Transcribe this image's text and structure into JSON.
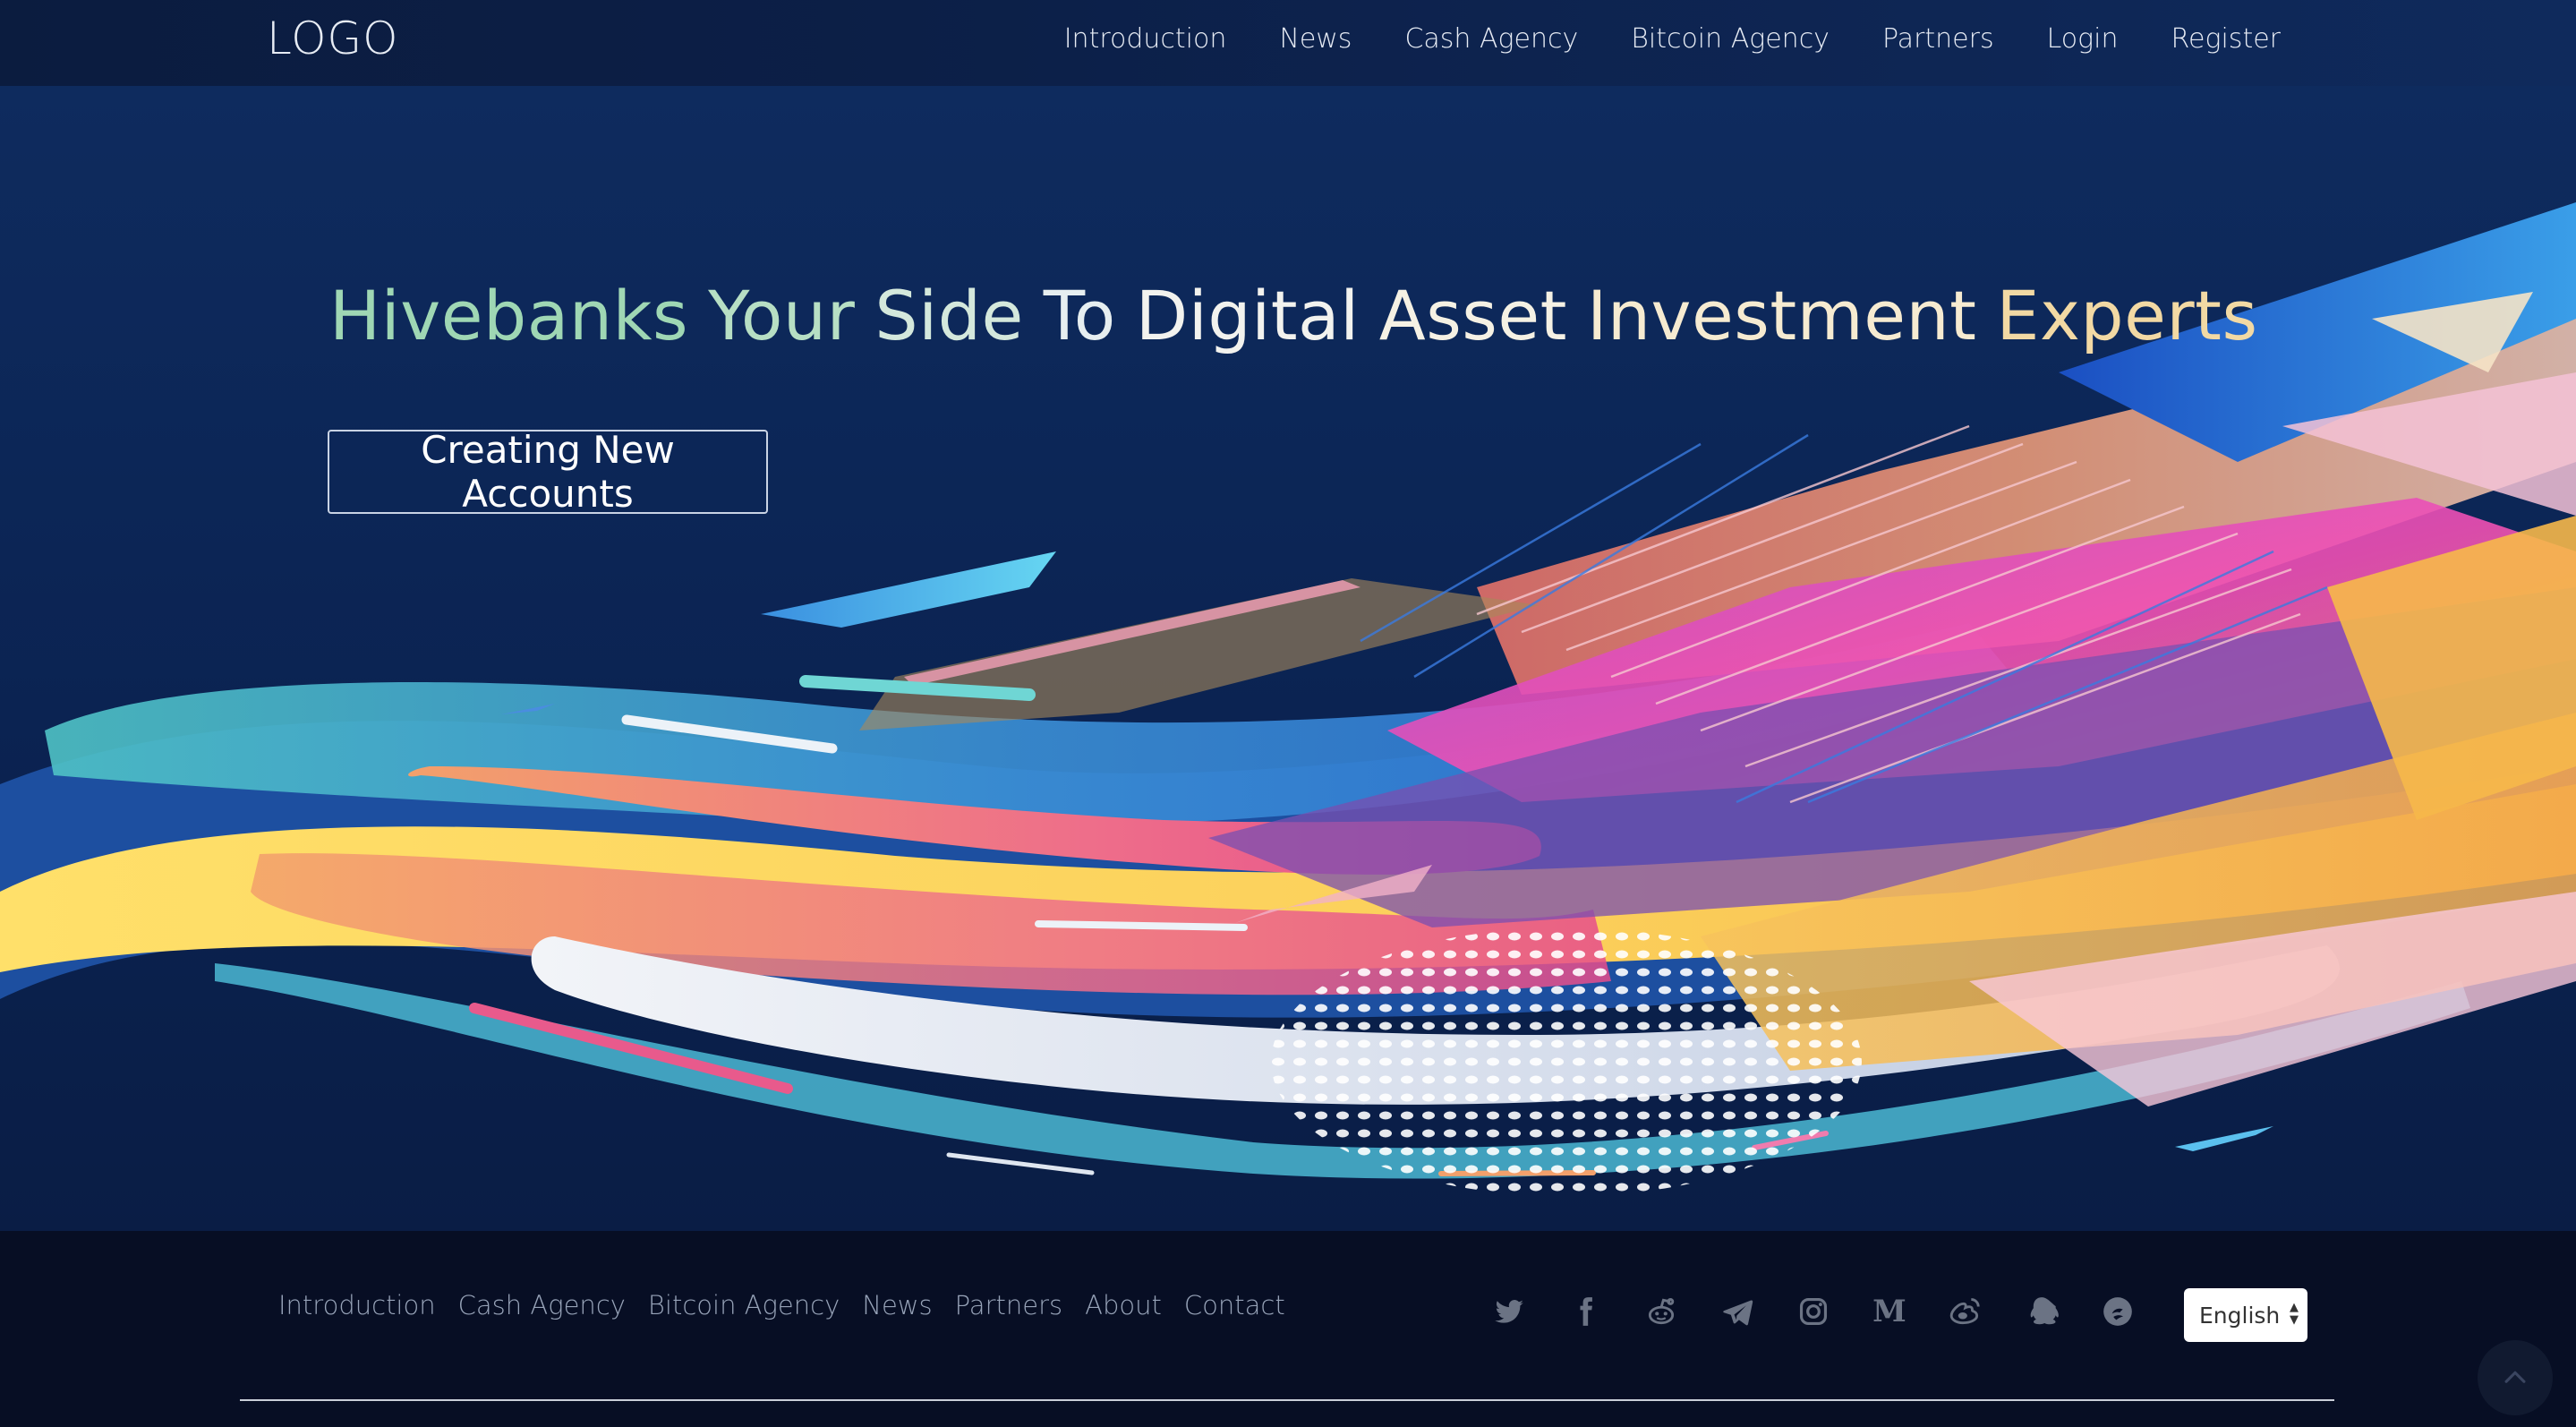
{
  "header": {
    "logo": "LOGO",
    "nav": [
      "Introduction",
      "News",
      "Cash Agency",
      "Bitcoin Agency",
      "Partners",
      "Login",
      "Register"
    ]
  },
  "hero": {
    "title_words": [
      {
        "text": "Hivebanks",
        "color": "#9fd7b4"
      },
      {
        "text": "Your",
        "color": "#b7dfc4"
      },
      {
        "text": "Side",
        "color": "#d4e8dc"
      },
      {
        "text": "To",
        "color": "#e6eef0"
      },
      {
        "text": "Digital",
        "color": "#f2f2ee"
      },
      {
        "text": "Asset",
        "color": "#f5f1e4"
      },
      {
        "text": "Investment",
        "color": "#f6ebd1"
      },
      {
        "text": "Experts",
        "color": "#f2d9a4"
      }
    ],
    "cta_label": "Creating New Accounts"
  },
  "footer": {
    "links": [
      "Introduction",
      "Cash Agency",
      "Bitcoin Agency",
      "News",
      "Partners",
      "About",
      "Contact"
    ],
    "socials": [
      "twitter-icon",
      "facebook-icon",
      "reddit-icon",
      "telegram-icon",
      "instagram-icon",
      "medium-icon",
      "weibo-icon",
      "qq-icon",
      "wechat-icon"
    ],
    "medium_glyph": "M",
    "language": "English"
  },
  "colors": {
    "header_bg": "#0b1c3f",
    "hero_bg": "#0d2a5b",
    "footer_bg": "#070e24",
    "accent_green": "#9fd7b4",
    "accent_gold": "#f2d9a4"
  }
}
